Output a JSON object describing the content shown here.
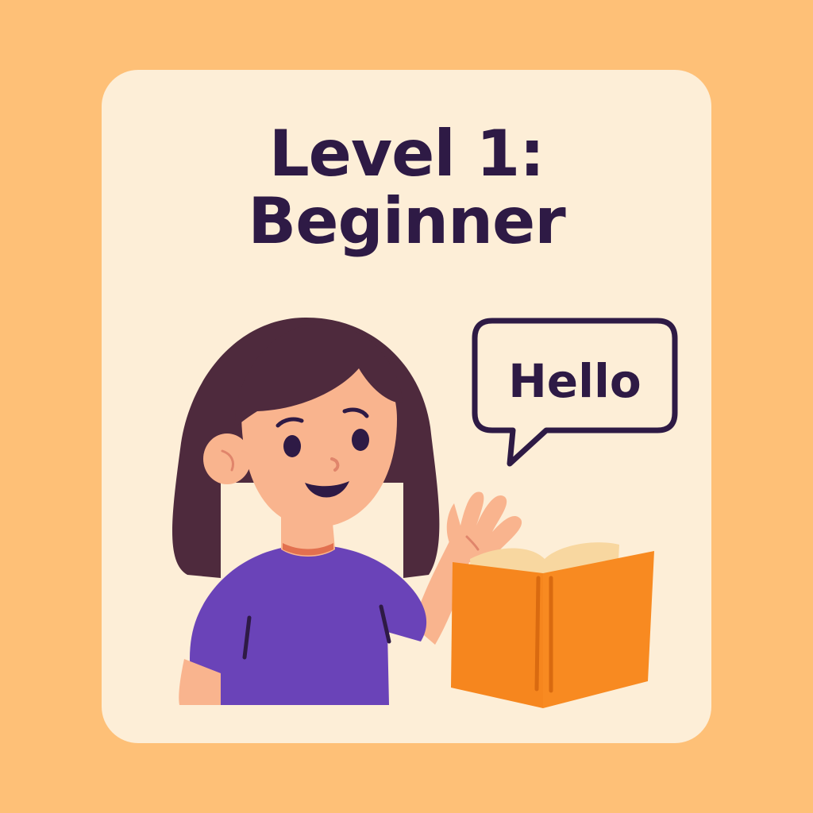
{
  "title": {
    "line1": "Level 1:",
    "line2": "Beginner"
  },
  "speech_bubble": {
    "text": "Hello"
  },
  "colors": {
    "background": "#FEC077",
    "card": "#FDEED7",
    "title_text": "#2E1A45",
    "hair": "#4E2A3D",
    "skin": "#F9B48E",
    "shirt": "#6A43B8",
    "book": "#F6861E",
    "book_pages": "#F8D7A0",
    "outline": "#2E1A45"
  },
  "icons": {
    "character": "girl-waving-icon",
    "book": "open-book-icon",
    "bubble": "speech-bubble-icon"
  }
}
